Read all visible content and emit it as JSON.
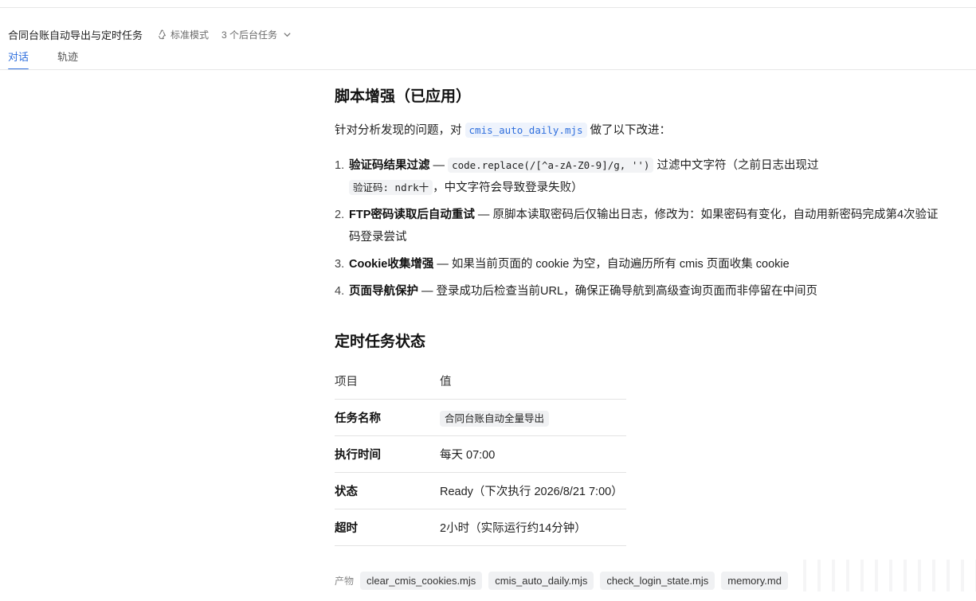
{
  "header": {
    "title": "合同台账自动导出与定时任务",
    "mode_icon": "recycle-icon",
    "mode_label": "标准模式",
    "bg_tasks_label": "3 个后台任务"
  },
  "tabs": [
    {
      "label": "对话",
      "active": true
    },
    {
      "label": "轨迹",
      "active": false
    }
  ],
  "section_enhance": {
    "heading": "脚本增强（已应用）",
    "intro_before": "针对分析发现的问题，对 ",
    "intro_code": "cmis_auto_daily.mjs",
    "intro_after": " 做了以下改进：",
    "items": [
      {
        "num": "1.",
        "title": "验证码结果过滤",
        "dash": " — ",
        "code": "code.replace(/[^a-zA-Z0-9]/g, '')",
        "text1": " 过滤中文字符（之前日志出现过",
        "code2": "验证码: ndrk十",
        "text2": "，中文字符会导致登录失败）"
      },
      {
        "num": "2.",
        "title": "FTP密码读取后自动重试",
        "text": " — 原脚本读取密码后仅输出日志，修改为：如果密码有变化，自动用新密码完成第4次验证码登录尝试"
      },
      {
        "num": "3.",
        "title": "Cookie收集增强",
        "text": " — 如果当前页面的 cookie 为空，自动遍历所有 cmis 页面收集 cookie"
      },
      {
        "num": "4.",
        "title": "页面导航保护",
        "text": " — 登录成功后检查当前URL，确保正确导航到高级查询页面而非停留在中间页"
      }
    ]
  },
  "section_schedule": {
    "heading": "定时任务状态",
    "table": {
      "header": {
        "key": "项目",
        "value": "值"
      },
      "rows": [
        {
          "key": "任务名称",
          "value": "合同台账自动全量导出"
        },
        {
          "key": "执行时间",
          "value": "每天 07:00"
        },
        {
          "key": "状态",
          "value": "Ready（下次执行 2026/8/21 7:00）"
        },
        {
          "key": "超时",
          "value": "2小时（实际运行约14分钟）"
        }
      ]
    }
  },
  "artifacts": {
    "label": "产物",
    "files": [
      "clear_cmis_cookies.mjs",
      "cmis_auto_daily.mjs",
      "check_login_state.mjs",
      "memory.md"
    ]
  },
  "colors": {
    "accent": "#2f6fdd",
    "chip_bg": "#f0f1f3",
    "divider": "#e3e3e3"
  }
}
